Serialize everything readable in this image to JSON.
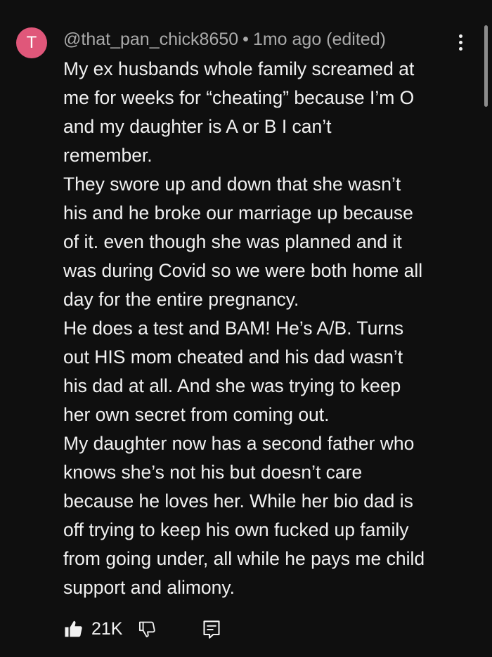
{
  "comment": {
    "avatar_letter": "T",
    "avatar_color": "#e0577a",
    "author": "@that_pan_chick8650",
    "separator": "•",
    "timestamp": "1mo ago (edited)",
    "paragraphs": [
      "My ex husbands whole family screamed at\nme for weeks for “cheating” because I’m O\nand my daughter is A or B I can’t\nremember.",
      "They swore up and down that she wasn’t\nhis and he broke our marriage up because\nof it. even though she was planned and it\nwas during Covid so we were both home all\nday for the entire pregnancy.",
      "He does a test and BAM! He’s A/B. Turns\nout HIS mom cheated and his dad wasn’t\nhis dad at all. And she was trying to keep\nher own secret from coming out.",
      "My daughter now has a second father who\nknows she’s not his but doesn’t care\nbecause he loves her. While her bio dad is\noff trying to keep his own fucked up family\nfrom going under, all while he pays me child\nsupport and alimony."
    ],
    "like_count": "21K",
    "icons": {
      "like": "thumbs-up-icon",
      "dislike": "thumbs-down-icon",
      "reply": "reply-icon",
      "menu": "more-vertical-icon"
    }
  }
}
